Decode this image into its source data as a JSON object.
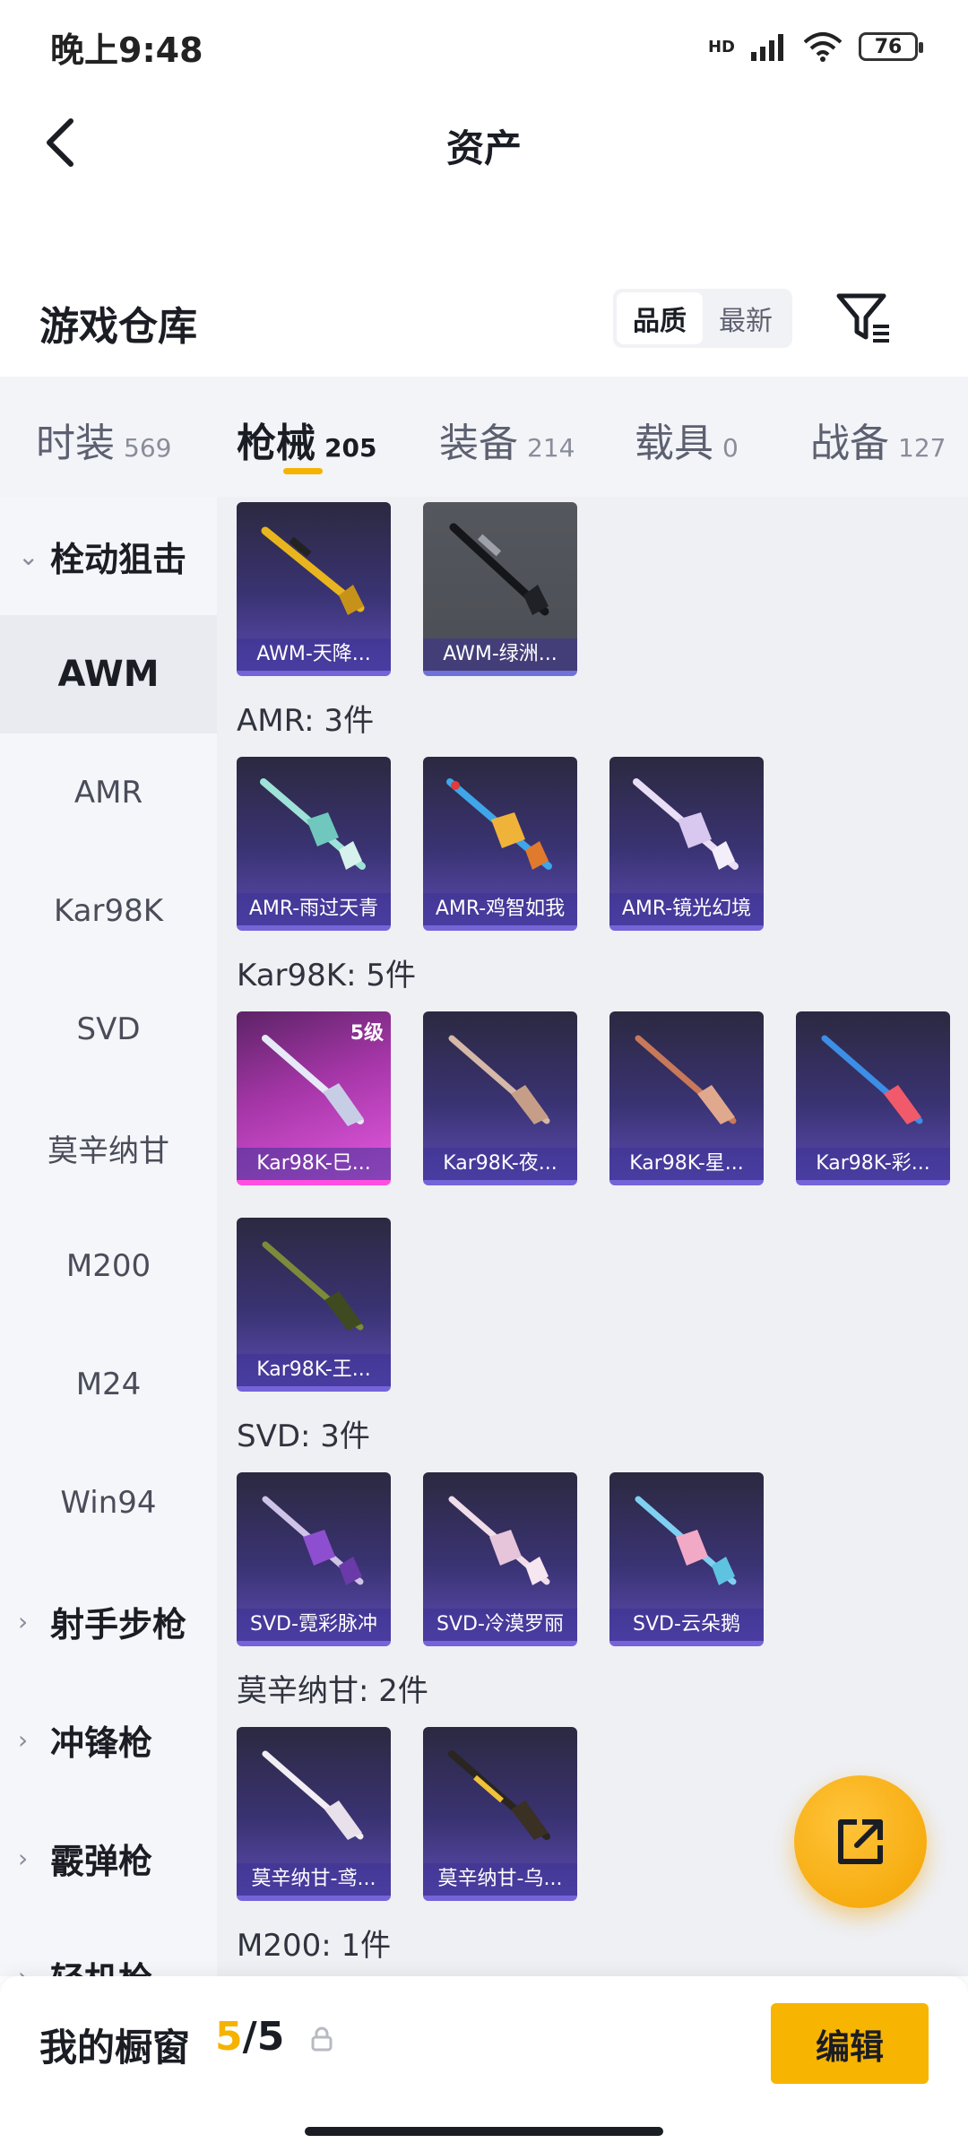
{
  "status": {
    "time": "晚上9:48",
    "network": "HD",
    "battery": "76"
  },
  "header": {
    "title": "资产"
  },
  "section": {
    "title": "游戏仓库",
    "sort_options": [
      "品质",
      "最新"
    ],
    "sort_selected": "品质"
  },
  "tabs": [
    {
      "label": "时装",
      "count": "569"
    },
    {
      "label": "枪械",
      "count": "205"
    },
    {
      "label": "装备",
      "count": "214"
    },
    {
      "label": "载具",
      "count": "0"
    },
    {
      "label": "战备",
      "count": "127"
    }
  ],
  "active_tab": "枪械",
  "sidebar": {
    "items": [
      {
        "label": "栓动狙击",
        "type": "group"
      },
      {
        "label": "AWM",
        "type": "item"
      },
      {
        "label": "AMR",
        "type": "item"
      },
      {
        "label": "Kar98K",
        "type": "item"
      },
      {
        "label": "SVD",
        "type": "item"
      },
      {
        "label": "莫辛纳甘",
        "type": "item"
      },
      {
        "label": "M200",
        "type": "item"
      },
      {
        "label": "M24",
        "type": "item"
      },
      {
        "label": "Win94",
        "type": "item"
      },
      {
        "label": "射手步枪",
        "type": "group"
      },
      {
        "label": "冲锋枪",
        "type": "group"
      },
      {
        "label": "霰弹枪",
        "type": "group"
      },
      {
        "label": "轻机枪",
        "type": "group"
      }
    ],
    "active": "AWM"
  },
  "groups": [
    {
      "header": "",
      "items": [
        {
          "label": "AWM-天降...",
          "style": "purple"
        },
        {
          "label": "AWM-绿洲...",
          "style": "gray"
        }
      ]
    },
    {
      "header": "AMR: 3件",
      "items": [
        {
          "label": "AMR-雨过天青",
          "style": "purple"
        },
        {
          "label": "AMR-鸡智如我",
          "style": "purple"
        },
        {
          "label": "AMR-镜光幻境",
          "style": "purple"
        }
      ]
    },
    {
      "header": "Kar98K: 5件",
      "items": [
        {
          "label": "Kar98K-巳...",
          "style": "pink",
          "level": "5级"
        },
        {
          "label": "Kar98K-夜...",
          "style": "purple"
        },
        {
          "label": "Kar98K-星...",
          "style": "purple"
        },
        {
          "label": "Kar98K-彩...",
          "style": "purple"
        },
        {
          "label": "Kar98K-王...",
          "style": "purple"
        }
      ]
    },
    {
      "header": "SVD: 3件",
      "items": [
        {
          "label": "SVD-霓彩脉冲",
          "style": "purple"
        },
        {
          "label": "SVD-冷漠罗丽",
          "style": "purple"
        },
        {
          "label": "SVD-云朵鹅",
          "style": "purple"
        }
      ]
    },
    {
      "header": "莫辛纳甘: 2件",
      "items": [
        {
          "label": "莫辛纳甘-鸢...",
          "style": "purple"
        },
        {
          "label": "莫辛纳甘-乌...",
          "style": "purple"
        }
      ]
    },
    {
      "header": "M200: 1件",
      "items": []
    }
  ],
  "showcase": {
    "label": "我的橱窗",
    "current": "5",
    "total": "/5"
  },
  "edit_button": "编辑",
  "colors": {
    "accent": "#f5b300",
    "card_purple": "#3a3373",
    "card_pink": "#e35ae0"
  },
  "icons": {
    "back": "chevron-left-icon",
    "filter": "filter-icon",
    "share": "share-external-icon",
    "lock": "lock-icon"
  }
}
